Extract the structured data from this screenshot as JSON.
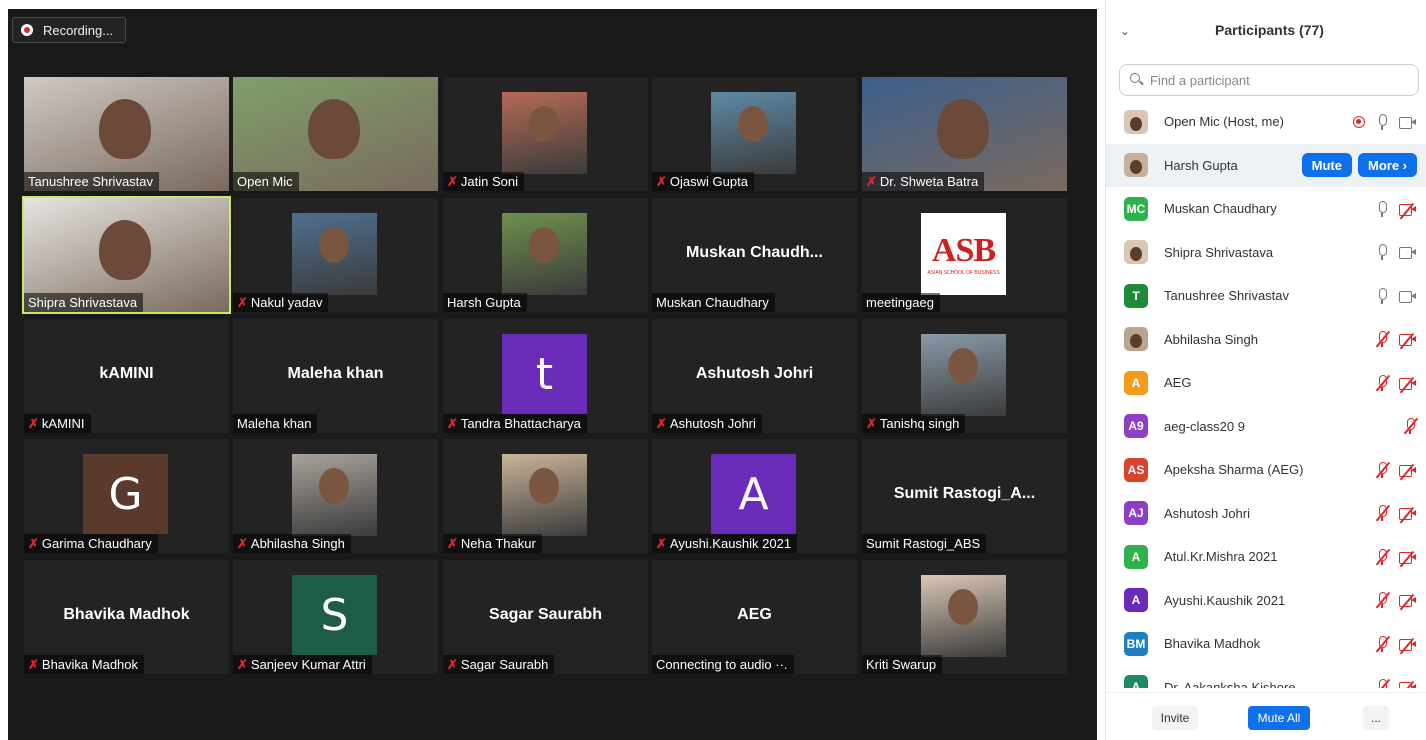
{
  "recording": {
    "label": "Recording..."
  },
  "tiles": [
    {
      "name": "Tanushree Shrivastav",
      "muted": false,
      "type": "video",
      "bg": "#cfc9c4"
    },
    {
      "name": "Open Mic",
      "muted": false,
      "type": "video",
      "bg": "#7f9f6a"
    },
    {
      "name": "Jatin Soni",
      "muted": true,
      "type": "video-small",
      "bg": "#b56a55"
    },
    {
      "name": "Ojaswi Gupta",
      "muted": true,
      "type": "video-small",
      "bg": "#5e8aa6"
    },
    {
      "name": "Dr. Shweta Batra",
      "muted": true,
      "type": "video",
      "bg": "#3d5f8c"
    },
    {
      "name": "Shipra Shrivastava",
      "muted": false,
      "type": "video",
      "bg": "#e7e4e0",
      "speaker": true
    },
    {
      "name": "Nakul yadav",
      "muted": true,
      "type": "video-small",
      "bg": "#4f6f8f"
    },
    {
      "name": "Harsh Gupta",
      "muted": false,
      "type": "video-small",
      "bg": "#6f8f4e"
    },
    {
      "name": "Muskan Chaudhary",
      "muted": false,
      "type": "text",
      "display": "Muskan Chaudh..."
    },
    {
      "name": "meetingaeg",
      "muted": false,
      "type": "logo",
      "logo": "ASB",
      "logo_sub": "ASIAN SCHOOL OF BUSINESS"
    },
    {
      "name": "kAMINI",
      "muted": true,
      "type": "text",
      "display": "kAMINI"
    },
    {
      "name": "Maleha khan",
      "muted": false,
      "type": "text",
      "display": "Maleha khan"
    },
    {
      "name": "Tandra Bhattacharya",
      "muted": true,
      "type": "letter",
      "letter": "t",
      "color": "#6a2bb8"
    },
    {
      "name": "Ashutosh Johri",
      "muted": true,
      "type": "text",
      "display": "Ashutosh Johri"
    },
    {
      "name": "Tanishq singh",
      "muted": true,
      "type": "video-small",
      "bg": "#8a9aa8"
    },
    {
      "name": "Garima Chaudhary",
      "muted": true,
      "type": "letter",
      "letter": "G",
      "color": "#5a3a2d"
    },
    {
      "name": "Abhilasha Singh",
      "muted": true,
      "type": "video-small",
      "bg": "#a8a29a"
    },
    {
      "name": "Neha Thakur",
      "muted": true,
      "type": "video-small",
      "bg": "#c9b49a"
    },
    {
      "name": "Ayushi.Kaushik 2021",
      "muted": true,
      "type": "letter",
      "letter": "A",
      "color": "#6a2bb8"
    },
    {
      "name": "Sumit Rastogi_ABS",
      "muted": false,
      "type": "text",
      "display": "Sumit  Rastogi_A..."
    },
    {
      "name": "Bhavika Madhok",
      "muted": true,
      "type": "text",
      "display": "Bhavika Madhok"
    },
    {
      "name": "Sanjeev Kumar Attri",
      "muted": true,
      "type": "letter",
      "letter": "S",
      "color": "#1d5c46"
    },
    {
      "name": "Sagar Saurabh",
      "muted": true,
      "type": "text",
      "display": "Sagar Saurabh"
    },
    {
      "name": "Connecting to audio ··.",
      "muted": false,
      "type": "text",
      "display": "AEG"
    },
    {
      "name": "Kriti Swarup",
      "muted": false,
      "type": "video-small",
      "bg": "#d9c7b6"
    }
  ],
  "panel": {
    "title": "Participants (77)",
    "search_placeholder": "Find a participant",
    "participants": [
      {
        "name": "Open Mic (Host, me)",
        "initials": "",
        "avatar_color": "#d8c7b4",
        "photo": true,
        "mic": "on",
        "cam": "on",
        "rec": true
      },
      {
        "name": "Harsh Gupta",
        "initials": "",
        "avatar_color": "#c5b09c",
        "photo": true,
        "hover": true,
        "mute_label": "Mute",
        "more_label": "More ›"
      },
      {
        "name": "Muskan Chaudhary",
        "initials": "MC",
        "avatar_color": "#2db34a",
        "mic": "on",
        "cam": "off"
      },
      {
        "name": "Shipra Shrivastava",
        "initials": "",
        "avatar_color": "#d8c7b4",
        "photo": true,
        "mic": "on",
        "cam": "on"
      },
      {
        "name": "Tanushree Shrivastav",
        "initials": "T",
        "avatar_color": "#1f8a3a",
        "mic": "on",
        "cam": "on"
      },
      {
        "name": "Abhilasha Singh",
        "initials": "",
        "avatar_color": "#b8a593",
        "photo": true,
        "mic": "off",
        "cam": "off"
      },
      {
        "name": "AEG",
        "initials": "A",
        "avatar_color": "#f29b1d",
        "mic": "off",
        "cam": "off"
      },
      {
        "name": "aeg-class20 9",
        "initials": "A9",
        "avatar_color": "#8e3fc6",
        "mic": "off",
        "cam": "none"
      },
      {
        "name": "Apeksha Sharma (AEG)",
        "initials": "AS",
        "avatar_color": "#d9432b",
        "mic": "off",
        "cam": "off"
      },
      {
        "name": "Ashutosh Johri",
        "initials": "AJ",
        "avatar_color": "#8e3fc6",
        "mic": "off",
        "cam": "off"
      },
      {
        "name": "Atul.Kr.Mishra 2021",
        "initials": "A",
        "avatar_color": "#2db34a",
        "mic": "off",
        "cam": "off"
      },
      {
        "name": "Ayushi.Kaushik 2021",
        "initials": "A",
        "avatar_color": "#6a2bb8",
        "mic": "off",
        "cam": "off"
      },
      {
        "name": "Bhavika Madhok",
        "initials": "BM",
        "avatar_color": "#1e7fc2",
        "mic": "off",
        "cam": "off"
      },
      {
        "name": "Dr. Aakanksha Kishore",
        "initials": "A",
        "avatar_color": "#1f8a6a",
        "mic": "off",
        "cam": "off"
      }
    ],
    "footer": {
      "invite": "Invite",
      "mute_all": "Mute All",
      "more": "..."
    }
  },
  "colors": {
    "accent": "#0e71eb",
    "muted_red": "#e0262b",
    "speaker_outline": "#c9e86e"
  }
}
